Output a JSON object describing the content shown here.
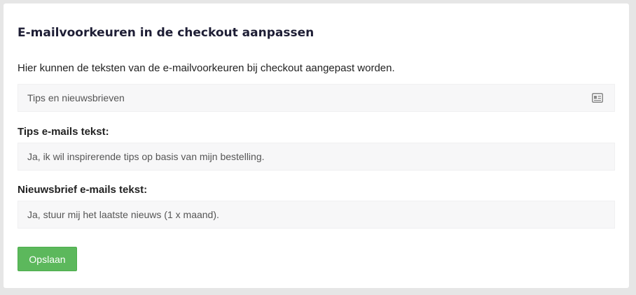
{
  "card": {
    "title": "E-mailvoorkeuren in de checkout aanpassen",
    "description": "Hier kunnen de teksten van de e-mailvoorkeuren bij checkout aangepast worden."
  },
  "preference_select": {
    "value": "Tips en nieuwsbrieven",
    "icon": "id-card-icon"
  },
  "tips_field": {
    "label": "Tips e-mails tekst:",
    "value": "Ja, ik wil inspirerende tips op basis van mijn bestelling."
  },
  "newsletter_field": {
    "label": "Nieuwsbrief e-mails tekst:",
    "value": "Ja, stuur mij het laatste nieuws (1 x maand)."
  },
  "actions": {
    "save_label": "Opslaan"
  },
  "colors": {
    "page_background": "#e6e6e6",
    "card_background": "#ffffff",
    "title": "#1e1e35",
    "field_background": "#f7f7f8",
    "save_button": "#5cb85c"
  }
}
